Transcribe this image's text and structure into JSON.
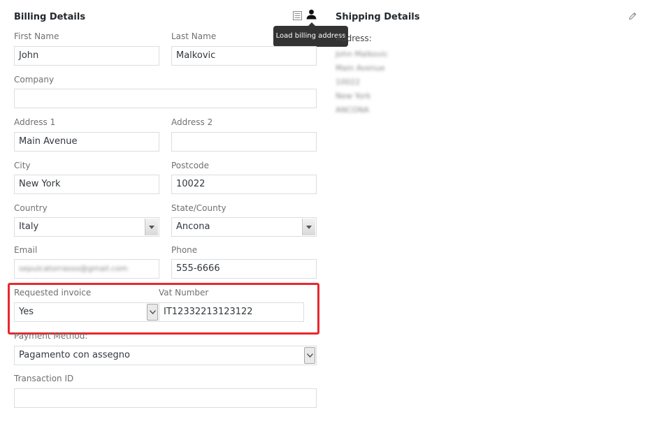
{
  "billing": {
    "title": "Billing Details",
    "tooltip": "Load billing address",
    "first_name": {
      "label": "First Name",
      "value": "John"
    },
    "last_name": {
      "label": "Last Name",
      "value": "Malkovic"
    },
    "company": {
      "label": "Company",
      "value": ""
    },
    "address1": {
      "label": "Address 1",
      "value": "Main Avenue"
    },
    "address2": {
      "label": "Address 2",
      "value": ""
    },
    "city": {
      "label": "City",
      "value": "New York"
    },
    "postcode": {
      "label": "Postcode",
      "value": "10022"
    },
    "country": {
      "label": "Country",
      "value": "Italy"
    },
    "state": {
      "label": "State/County",
      "value": "Ancona"
    },
    "email": {
      "label": "Email",
      "value": "sepulcatorrasso@gmail.com"
    },
    "phone": {
      "label": "Phone",
      "value": "555-6666"
    },
    "requested_invoice": {
      "label": "Requested invoice",
      "value": "Yes"
    },
    "vat_number": {
      "label": "Vat Number",
      "value": "IT12332213123122"
    },
    "payment_method": {
      "label": "Payment Method:",
      "value": "Pagamento con assegno"
    },
    "transaction_id": {
      "label": "Transaction ID",
      "value": ""
    }
  },
  "shipping": {
    "title": "Shipping Details",
    "address_label": "Address:",
    "address_lines": [
      "John Malkovic",
      "Main Avenue",
      "10022",
      "New York",
      "ANCONA"
    ]
  },
  "colors": {
    "highlight": "#e9272d",
    "tooltip_bg": "#333333"
  }
}
